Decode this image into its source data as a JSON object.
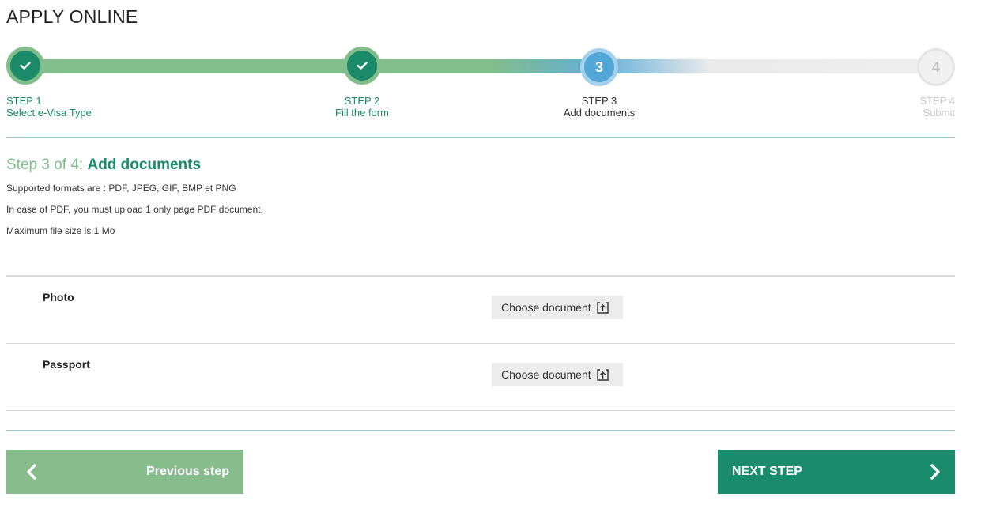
{
  "page": {
    "title": "APPLY ONLINE"
  },
  "stepper": {
    "steps": [
      {
        "number": "1",
        "step_label": "STEP 1",
        "name": "Select e-Visa Type",
        "status": "done"
      },
      {
        "number": "2",
        "step_label": "STEP 2",
        "name": "Fill the form",
        "status": "done"
      },
      {
        "number": "3",
        "step_label": "STEP 3",
        "name": "Add documents",
        "status": "current"
      },
      {
        "number": "4",
        "step_label": "STEP 4",
        "name": "Submit",
        "status": "todo"
      }
    ],
    "icons": {
      "done": "check-icon"
    }
  },
  "section": {
    "prefix": "Step 3 of 4:",
    "title": "Add documents",
    "info": [
      "Supported formats are : PDF, JPEG, GIF, BMP et PNG",
      "In case of PDF, you must upload 1 only page PDF document.",
      "Maximum file size is 1 Mo"
    ]
  },
  "documents": [
    {
      "label": "Photo",
      "button_label": "Choose document",
      "icon": "upload-icon"
    },
    {
      "label": "Passport",
      "button_label": "Choose document",
      "icon": "upload-icon"
    }
  ],
  "nav": {
    "prev_label": "Previous step",
    "next_label": "NEXT STEP",
    "prev_icon": "chevron-left-icon",
    "next_icon": "chevron-right-icon"
  },
  "colors": {
    "accent_green": "#1a8a68",
    "light_green": "#82bd8c",
    "current_blue": "#52a7d6",
    "inactive_grey": "#c9c9c9"
  }
}
